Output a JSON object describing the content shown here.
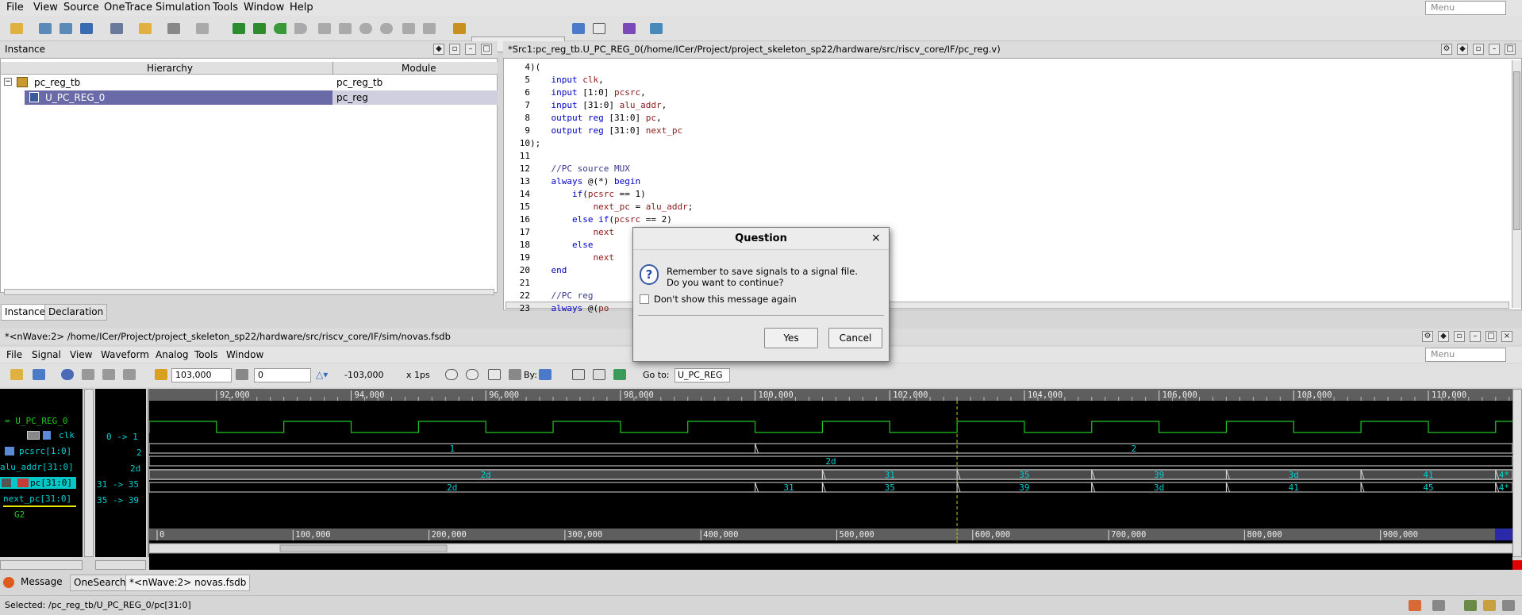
{
  "menubar": {
    "items": [
      "File",
      "View",
      "Source",
      "OneTrace",
      "Simulation",
      "Tools",
      "Window",
      "Help"
    ],
    "search_placeholder": "Menu"
  },
  "instance_panel": {
    "title": "Instance",
    "col_hierarchy": "Hierarchy",
    "col_module": "Module",
    "rows": [
      {
        "name": "pc_reg_tb",
        "module": "pc_reg_tb"
      },
      {
        "name": "U_PC_REG_0",
        "module": "pc_reg"
      }
    ],
    "tabs": [
      "Instance",
      "Declaration"
    ]
  },
  "source_panel": {
    "title": "*Src1:pc_reg_tb.U_PC_REG_0(/home/ICer/Project/project_skeleton_sp22/hardware/src/riscv_core/IF/pc_reg.v)",
    "lines": [
      {
        "n": "4",
        "t": ")("
      },
      {
        "n": "5",
        "t": "    input clk,"
      },
      {
        "n": "6",
        "t": "    input [1:0] pcsrc,"
      },
      {
        "n": "7",
        "t": "    input [31:0] alu_addr,"
      },
      {
        "n": "8",
        "t": "    output reg [31:0] pc,"
      },
      {
        "n": "9",
        "t": "    output reg [31:0] next_pc"
      },
      {
        "n": "10",
        "t": ");"
      },
      {
        "n": "11",
        "t": ""
      },
      {
        "n": "12",
        "t": "    //PC source MUX"
      },
      {
        "n": "13",
        "t": "    always @(*) begin"
      },
      {
        "n": "14",
        "t": "        if(pcsrc == 1)"
      },
      {
        "n": "15",
        "t": "            next_pc = alu_addr;"
      },
      {
        "n": "16",
        "t": "        else if(pcsrc == 2)"
      },
      {
        "n": "17",
        "t": "            next"
      },
      {
        "n": "18",
        "t": "        else"
      },
      {
        "n": "19",
        "t": "            next"
      },
      {
        "n": "20",
        "t": "    end"
      },
      {
        "n": "21",
        "t": ""
      },
      {
        "n": "22",
        "t": "    //PC reg"
      },
      {
        "n": "23",
        "t": "    always @(po"
      }
    ]
  },
  "nwave": {
    "title": "*<nWave:2> /home/ICer/Project/project_skeleton_sp22/hardware/src/riscv_core/IF/sim/novas.fsdb",
    "menu": [
      "File",
      "Signal",
      "View",
      "Waveform",
      "Analog",
      "Tools",
      "Window"
    ],
    "search_placeholder": "Menu",
    "cursor_time": "103,000",
    "marker_time": "0",
    "delta": "-103,000",
    "time_unit": "x 1ps",
    "by_label": "By:",
    "goto_label": "Go to:",
    "goto_value": "U_PC_REG",
    "signals": [
      {
        "name": "= U_PC_REG_0",
        "value": ""
      },
      {
        "name": "clk",
        "value": "0 -> 1"
      },
      {
        "name": "pcsrc[1:0]",
        "value": "2"
      },
      {
        "name": "alu_addr[31:0]",
        "value": "2d"
      },
      {
        "name": "pc[31:0]",
        "value": "31 -> 35"
      },
      {
        "name": "next_pc[31:0]",
        "value": "35 -> 39"
      },
      {
        "name": "G2",
        "value": ""
      }
    ],
    "time_ticks": [
      "92,000",
      "94,000",
      "96,000",
      "98,000",
      "100,000",
      "102,000",
      "104,000",
      "106,000",
      "108,000",
      "110,000"
    ],
    "overview_ticks": [
      "0",
      "100,000",
      "200,000",
      "300,000",
      "400,000",
      "500,000",
      "600,000",
      "700,000",
      "800,000",
      "900,000",
      "00"
    ],
    "bus_values": {
      "pcsrc": [
        "1",
        "2"
      ],
      "alu_addr": [
        "2d"
      ],
      "pc": [
        "2d",
        "31",
        "35",
        "39",
        "3d",
        "41",
        "4*"
      ],
      "next_pc": [
        "2d",
        "31",
        "35",
        "39",
        "3d",
        "41",
        "45",
        "4*"
      ]
    }
  },
  "bottom_tabs": [
    "Message",
    "OneSearch",
    "*<nWave:2> novas.fsdb"
  ],
  "status": "Selected: /pc_reg_tb/U_PC_REG_0/pc[31:0]",
  "dialog": {
    "title": "Question",
    "message_line1": "Remember to save signals to a signal file.",
    "message_line2": "Do you want to continue?",
    "checkbox_label": "Don't show this message again",
    "yes": "Yes",
    "cancel": "Cancel"
  },
  "colors": {
    "wave_green": "#22c822",
    "wave_cyan": "#00d0d0",
    "wave_bg": "#000000",
    "selection": "#6a6aa8"
  }
}
